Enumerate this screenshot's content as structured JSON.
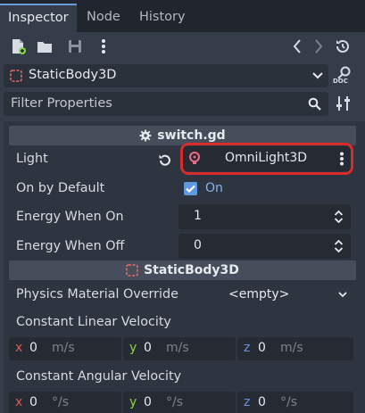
{
  "tabs": [
    {
      "label": "Inspector",
      "active": true
    },
    {
      "label": "Node",
      "active": false
    },
    {
      "label": "History",
      "active": false
    }
  ],
  "toolbar": {
    "icons": [
      "new-resource-icon",
      "open-folder-icon",
      "save-icon",
      "more-options-icon",
      "back-icon",
      "forward-icon",
      "history-icon"
    ]
  },
  "object": {
    "name": "StaticBody3D",
    "doc_label": "DOC"
  },
  "filter": {
    "placeholder": "Filter Properties"
  },
  "script_section": {
    "title": "switch.gd",
    "properties": {
      "light_label": "Light",
      "light_value": "OmniLight3D",
      "on_by_default_label": "On by Default",
      "on_by_default_value": "On",
      "on_by_default_checked": true,
      "energy_on_label": "Energy When On",
      "energy_on_value": "1",
      "energy_off_label": "Energy When Off",
      "energy_off_value": "0"
    }
  },
  "body_section": {
    "title": "StaticBody3D",
    "physics_material_label": "Physics Material Override",
    "physics_material_value": "<empty>",
    "linear_velocity_label": "Constant Linear Velocity",
    "linear_velocity": {
      "x": "0",
      "y": "0",
      "z": "0",
      "unit": "m/s"
    },
    "angular_velocity_label": "Constant Angular Velocity",
    "angular_velocity": {
      "x": "0",
      "y": "0",
      "z": "0",
      "unit": "°/s"
    }
  },
  "colors": {
    "accent": "#6c9ad9",
    "highlight_border": "#d92b2b",
    "axis_x": "#d85a5a",
    "axis_y": "#8ad24a",
    "axis_z": "#6a8fe0",
    "checkbox": "#5e9ae0"
  }
}
